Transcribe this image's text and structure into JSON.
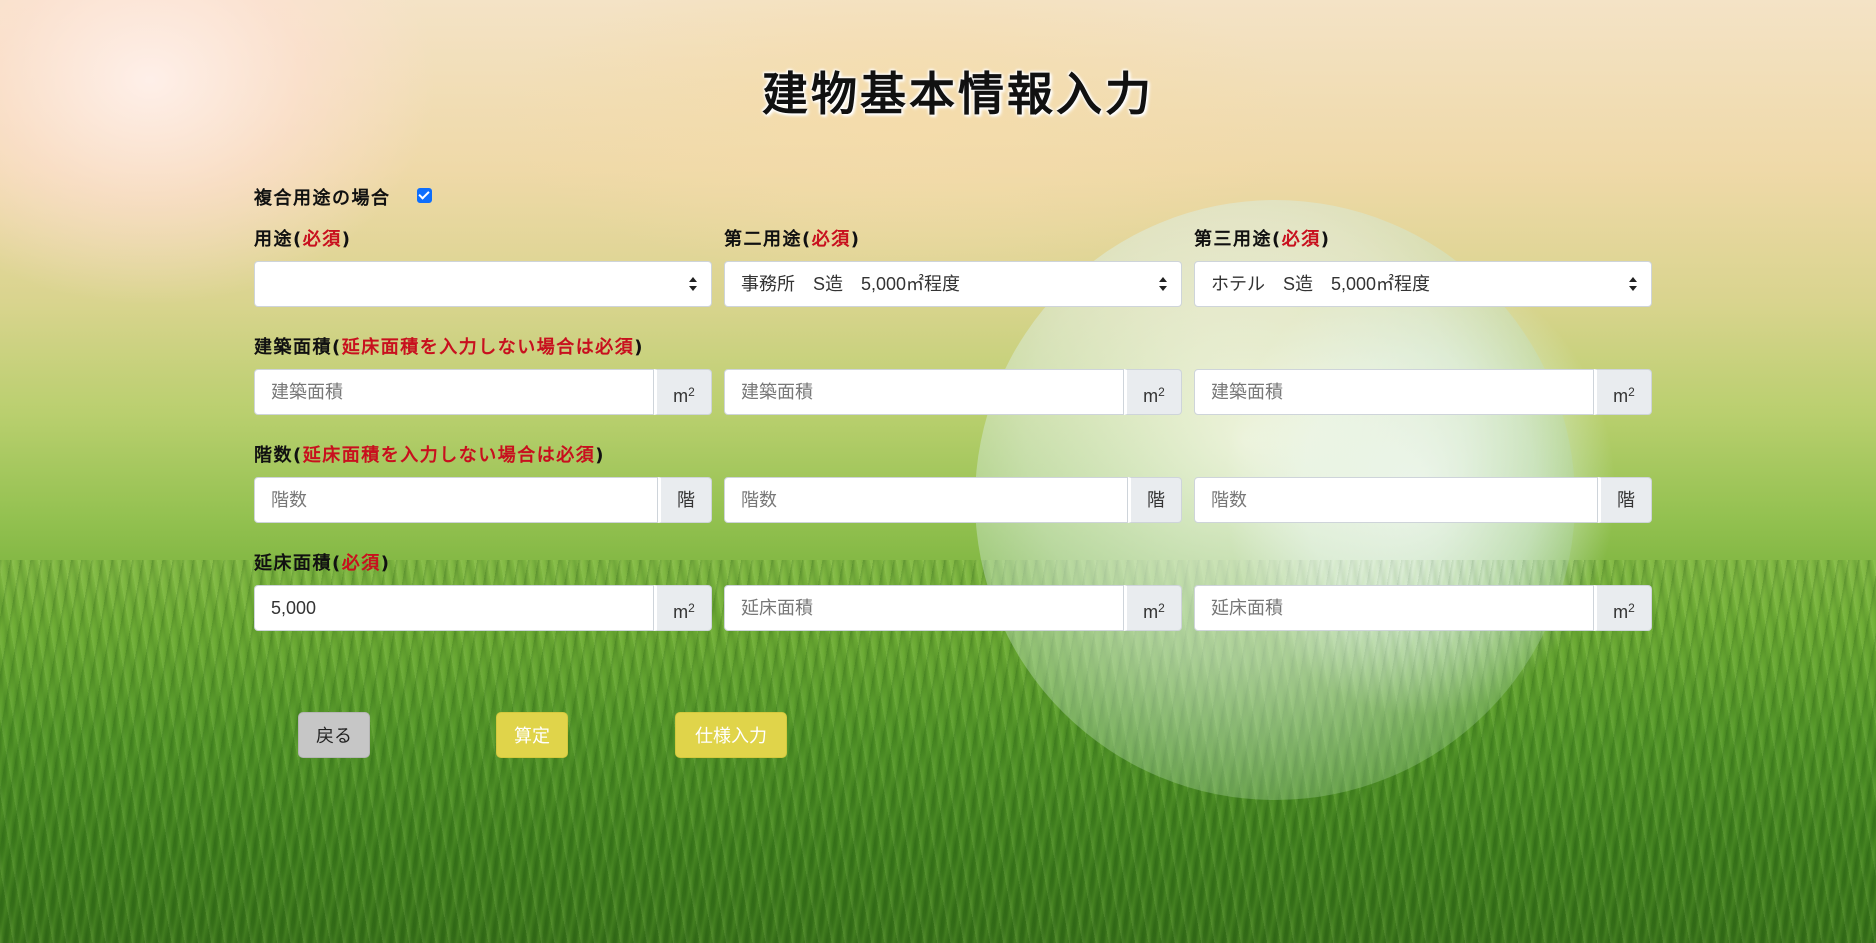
{
  "page": {
    "title": "建物基本情報入力"
  },
  "mixed_use": {
    "label": "複合用途の場合",
    "checked": true
  },
  "columns": [
    {
      "use_label": "用途(",
      "use_required": "必須",
      "use_close": ")",
      "use_value": "",
      "building_area_placeholder": "建築面積",
      "floors_placeholder": "階数",
      "floor_area_value": "5,000",
      "floor_area_placeholder": "延床面積"
    },
    {
      "use_label": "第二用途(",
      "use_required": "必須",
      "use_close": ")",
      "use_value": "事務所　S造　5,000㎡程度",
      "building_area_placeholder": "建築面積",
      "floors_placeholder": "階数",
      "floor_area_value": "",
      "floor_area_placeholder": "延床面積"
    },
    {
      "use_label": "第三用途(",
      "use_required": "必須",
      "use_close": ")",
      "use_value": "ホテル　S造　5,000㎡程度",
      "building_area_placeholder": "建築面積",
      "floors_placeholder": "階数",
      "floor_area_value": "",
      "floor_area_placeholder": "延床面積"
    }
  ],
  "labels": {
    "building_area": "建築面積(",
    "building_area_required": "延床面積を入力しない場合は必須",
    "floors": "階数(",
    "floors_required": "延床面積を入力しない場合は必須",
    "floor_area": "延床面積(",
    "floor_area_required": "必須",
    "close": ")"
  },
  "units": {
    "area_base": "m",
    "area_exp": "2",
    "floor": "階"
  },
  "buttons": {
    "back": "戻る",
    "calculate": "算定",
    "spec_input": "仕様入力"
  },
  "colors": {
    "required": "#c8101e",
    "accent_button": "#e0d44a",
    "back_button": "#c6c6c6"
  }
}
